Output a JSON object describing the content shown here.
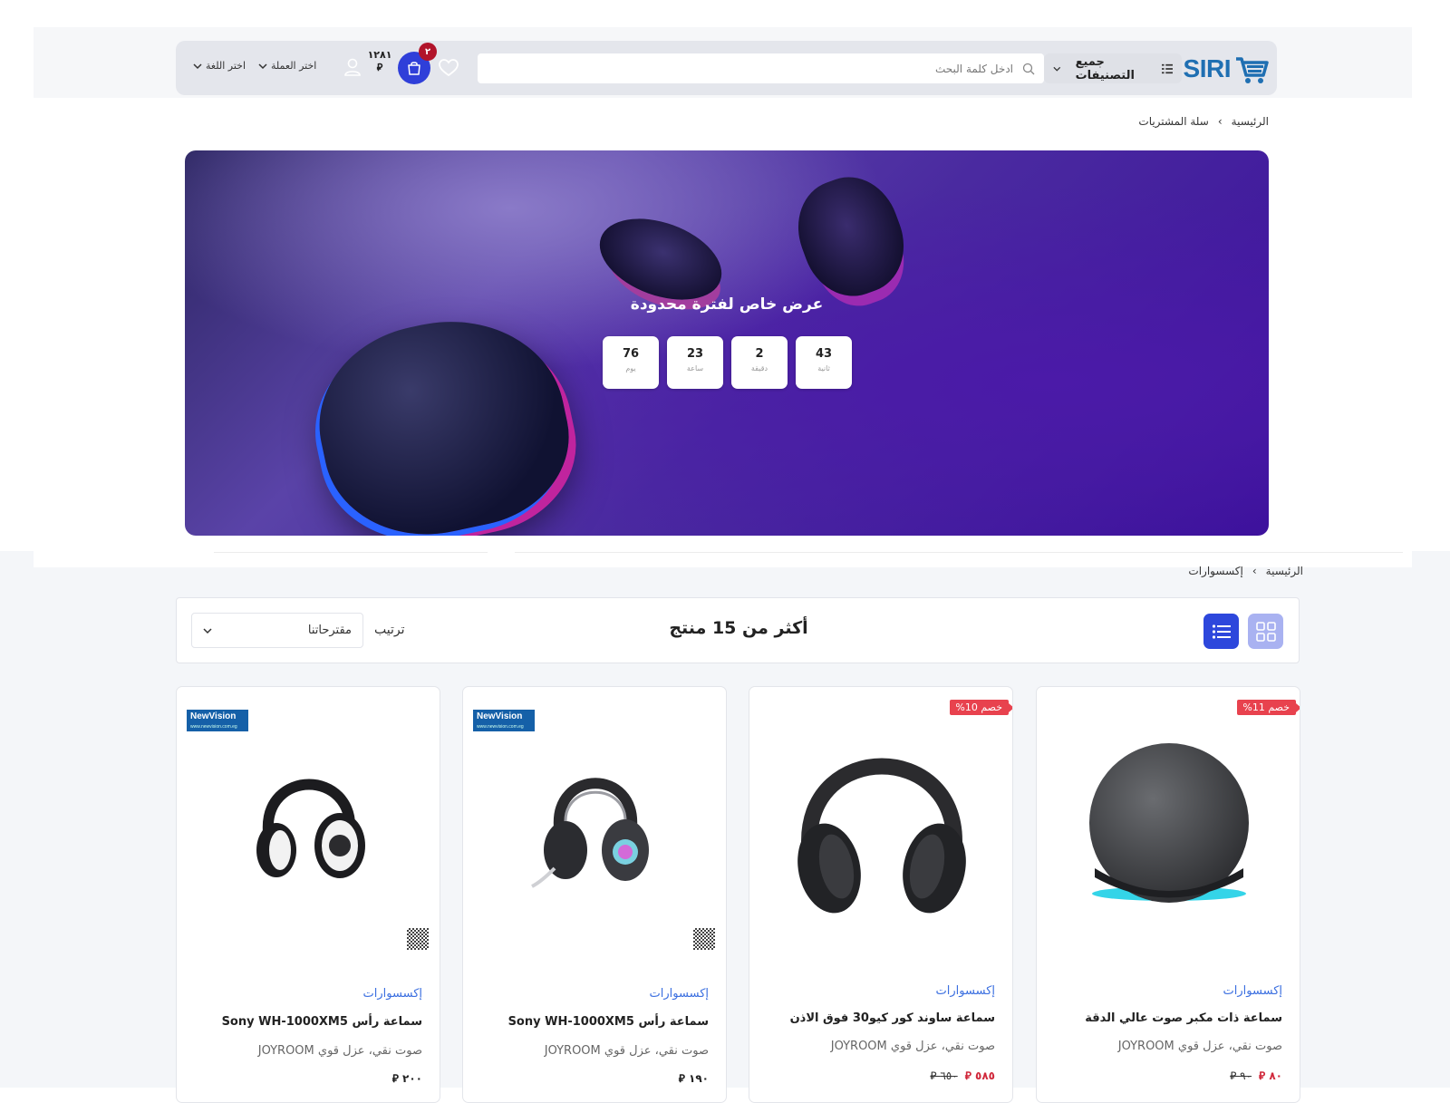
{
  "header": {
    "logo_text": "SIRI",
    "categories_label": "جميع التصنيفات",
    "search_placeholder": "ادخل كلمة البحث",
    "cart_count": "٢",
    "cart_total": "١٢٨١",
    "cart_currency": "⃁",
    "currency_label": "اختر العملة",
    "language_label": "اختر اللغة"
  },
  "breadcrumb_top": {
    "home": "الرئيسية",
    "sep": "›",
    "current": "سلة المشتريات"
  },
  "hero": {
    "title": "عرض خاص لفترة محدودة",
    "countdown": [
      {
        "value": "43",
        "label": "ثانية"
      },
      {
        "value": "2",
        "label": "دقيقة"
      },
      {
        "value": "23",
        "label": "ساعة"
      },
      {
        "value": "76",
        "label": "يوم"
      }
    ]
  },
  "breadcrumb_products": {
    "home": "الرئيسية",
    "sep": "›",
    "current": "إكسسوارات"
  },
  "toolbar": {
    "count_title": "أكثر من 15 منتج",
    "sort_label": "ترتيب",
    "sort_value": "مقترحاتنا"
  },
  "products": [
    {
      "badge": "خصم 11%",
      "category": "إكسسوارات",
      "title": "سماعة ذات مكبر صوت عالي الدقة",
      "description": "صوت نقي، عزل قوي JOYROOM",
      "price_now": "٨٠ ⃁",
      "price_old": "٩٠ ⃁",
      "image": "smart-speaker"
    },
    {
      "badge": "خصم 10%",
      "category": "إكسسوارات",
      "title": "سماعة ساوند كور كيو30 فوق الاذن",
      "description": "صوت نقي، عزل قوي JOYROOM",
      "price_now": "٥٨٥ ⃁",
      "price_old": "٦٥٠ ⃁",
      "image": "over-ear-headphones"
    },
    {
      "brand_logo": "NewVision",
      "category": "إكسسوارات",
      "title": "سماعة رأس Sony WH-1000XM5",
      "description": "صوت نقي، عزل قوي JOYROOM",
      "price_now": "١٩٠ ⃁",
      "image": "gaming-headset"
    },
    {
      "brand_logo": "NewVision",
      "category": "إكسسوارات",
      "title": "سماعة رأس Sony WH-1000XM5",
      "description": "صوت نقي، عزل قوي JOYROOM",
      "price_now": "٢٠٠ ⃁",
      "image": "bluetooth-headphones"
    }
  ],
  "colors": {
    "accent": "#2d47dc",
    "sale": "#e8424e",
    "link": "#3b6fe0"
  }
}
